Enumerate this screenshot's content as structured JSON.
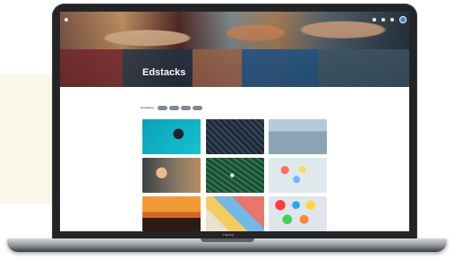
{
  "header": {
    "title": "Edstacks"
  },
  "filters": {
    "label": "Hoofdgang"
  },
  "laptop": {
    "brand": "Laptop"
  },
  "icons": {
    "menu": "menu-icon",
    "notification": "notification-icon",
    "settings": "settings-icon",
    "profile": "profile-icon"
  },
  "colors": {
    "accent": "#3b7dd8",
    "chip": "#7f8996",
    "laptop": "#222426",
    "panel": "#f8f7e8"
  }
}
